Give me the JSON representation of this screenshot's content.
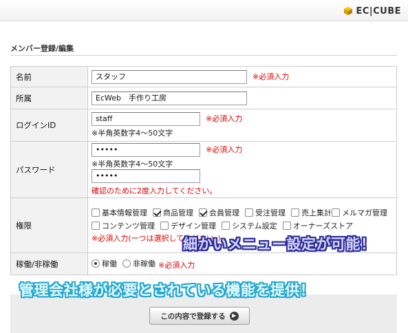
{
  "header": {
    "logo_text": "EC|CUBE"
  },
  "form": {
    "title": "メンバー登録/編集",
    "name": {
      "label": "名前",
      "value": "スタッフ",
      "required": "※必須入力"
    },
    "department": {
      "label": "所属",
      "value": "EcWeb　手作り工房"
    },
    "login_id": {
      "label": "ログインID",
      "value": "staff",
      "required": "※必須入力",
      "note": "※半角英数字4～50文字"
    },
    "password": {
      "label": "パスワード",
      "value": "•••••",
      "confirm_value": "•••••",
      "required": "※必須入力",
      "note": "※半角英数字4～50文字",
      "confirm_note": "確認のために2度入力してください。"
    },
    "permissions": {
      "label": "権限",
      "items": [
        {
          "label": "基本情報管理",
          "checked": false
        },
        {
          "label": "商品管理",
          "checked": true
        },
        {
          "label": "会員管理",
          "checked": true
        },
        {
          "label": "受注管理",
          "checked": false
        },
        {
          "label": "売上集計",
          "checked": false
        },
        {
          "label": "メルマガ管理",
          "checked": false
        },
        {
          "label": "コンテンツ管理",
          "checked": false
        },
        {
          "label": "デザイン管理",
          "checked": false
        },
        {
          "label": "システム設定",
          "checked": false
        },
        {
          "label": "オーナーズストア",
          "checked": false
        }
      ],
      "required": "※必須入力(一つは選択してください。)"
    },
    "status": {
      "label": "稼働/非稼働",
      "options": [
        {
          "label": "稼働",
          "selected": true
        },
        {
          "label": "非稼働",
          "selected": false
        }
      ],
      "required": "※必須入力"
    },
    "submit_label": "この内容で登録する"
  },
  "overlays": {
    "menu_caption": "細かいメニュー設定が可能！",
    "feature_caption": "管理会社様が必要とされている機能を提供！"
  },
  "colors": {
    "required_text": "#e00000",
    "label_bg": "#f2f2f2"
  }
}
